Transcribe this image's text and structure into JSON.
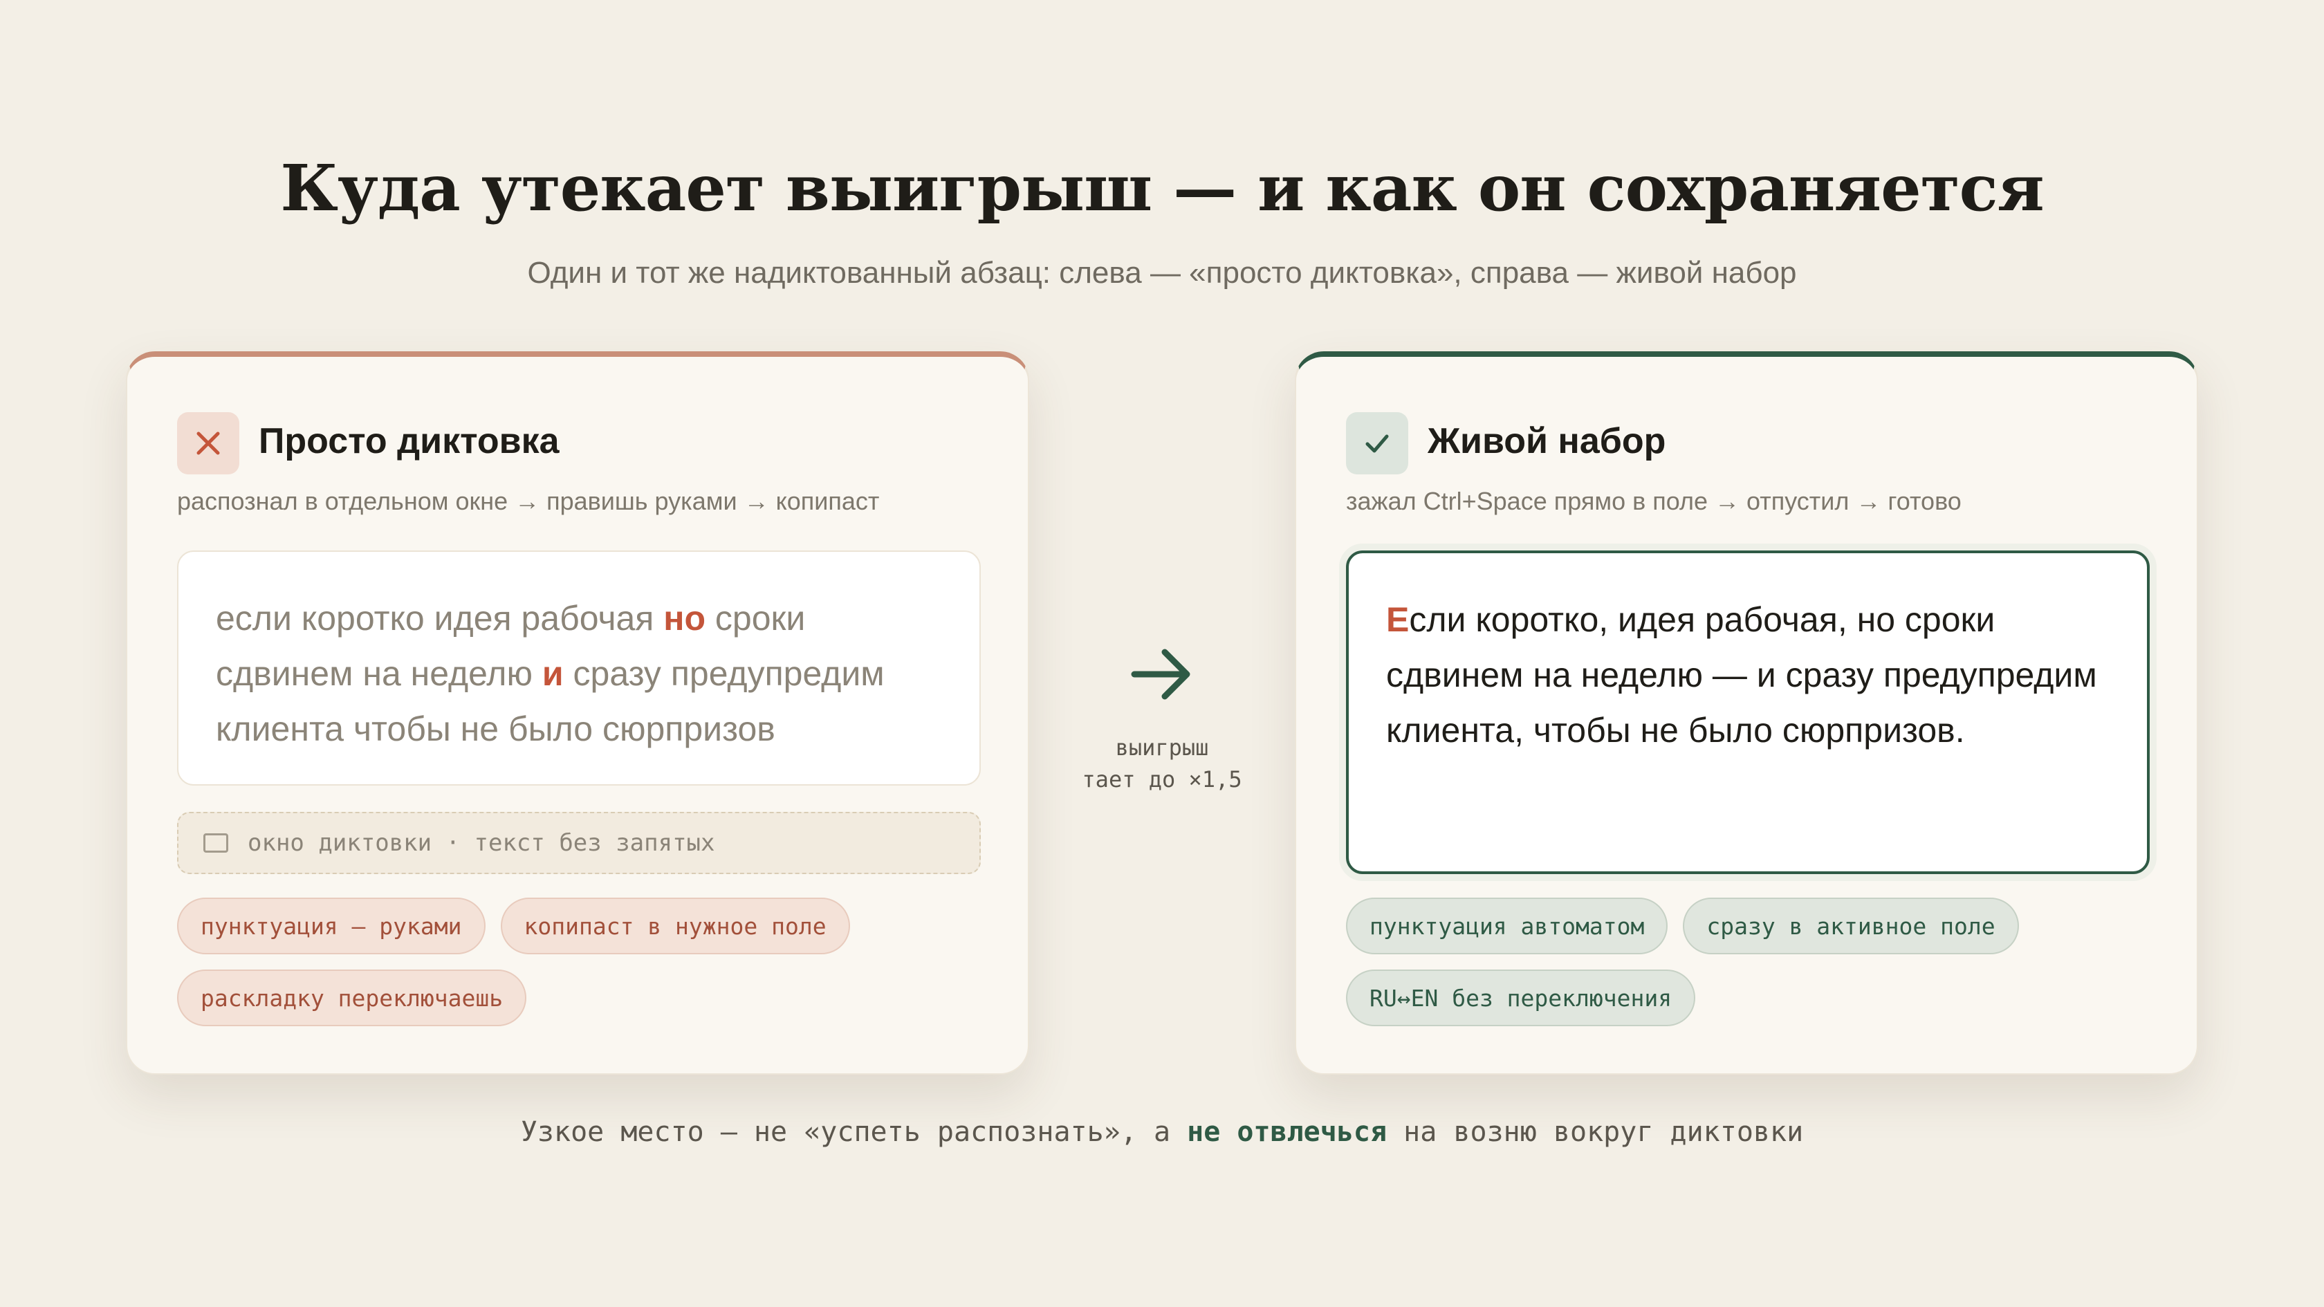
{
  "header": {
    "title": "Куда утекает выигрыш — и как он сохраняется",
    "subtitle": "Один и тот же надиктованный абзац: слева — «просто диктовка», справа — живой набор"
  },
  "left_card": {
    "icon": "close-icon",
    "title": "Просто диктовка",
    "subtitle": "распознал в отдельном окне → правишь руками → копипаст",
    "text_line1_a": "если коротко идея рабочая ",
    "text_line1_hl": "но",
    "text_line1_b": " сроки",
    "text_line2_a": "сдвинем на неделю ",
    "text_line2_hl": "и",
    "text_line2_b": " сразу предупредим",
    "text_line3": "клиента чтобы не было сюрпризов",
    "dict_bar": "окно диктовки · текст без запятых",
    "chips": [
      "пунктуация — руками",
      "копипаст в нужное поле",
      "раскладку переключаешь"
    ],
    "accent": "#c4553a"
  },
  "right_card": {
    "icon": "check-icon",
    "title": "Живой набор",
    "subtitle": "зажал Ctrl+Space прямо в поле → отпустил → готово",
    "text_first_letter": "Е",
    "text_line1": "сли коротко, идея рабочая, но сроки",
    "text_line2": "сдвинем на неделю — и сразу предупредим",
    "text_line3": "клиента, чтобы не было сюрпризов.",
    "chips": [
      "пунктуация автоматом",
      "сразу в активное поле",
      "RU↔EN без переключения"
    ],
    "accent": "#2f5a45"
  },
  "middle": {
    "icon": "arrow-right-icon",
    "label_line1": "выигрыш",
    "label_line2": "тает до ×1,5"
  },
  "footer": {
    "text_a": "Узкое место — не «успеть распознать», а ",
    "text_bold": "не отвлечься",
    "text_b": " на возню вокруг диктовки"
  }
}
